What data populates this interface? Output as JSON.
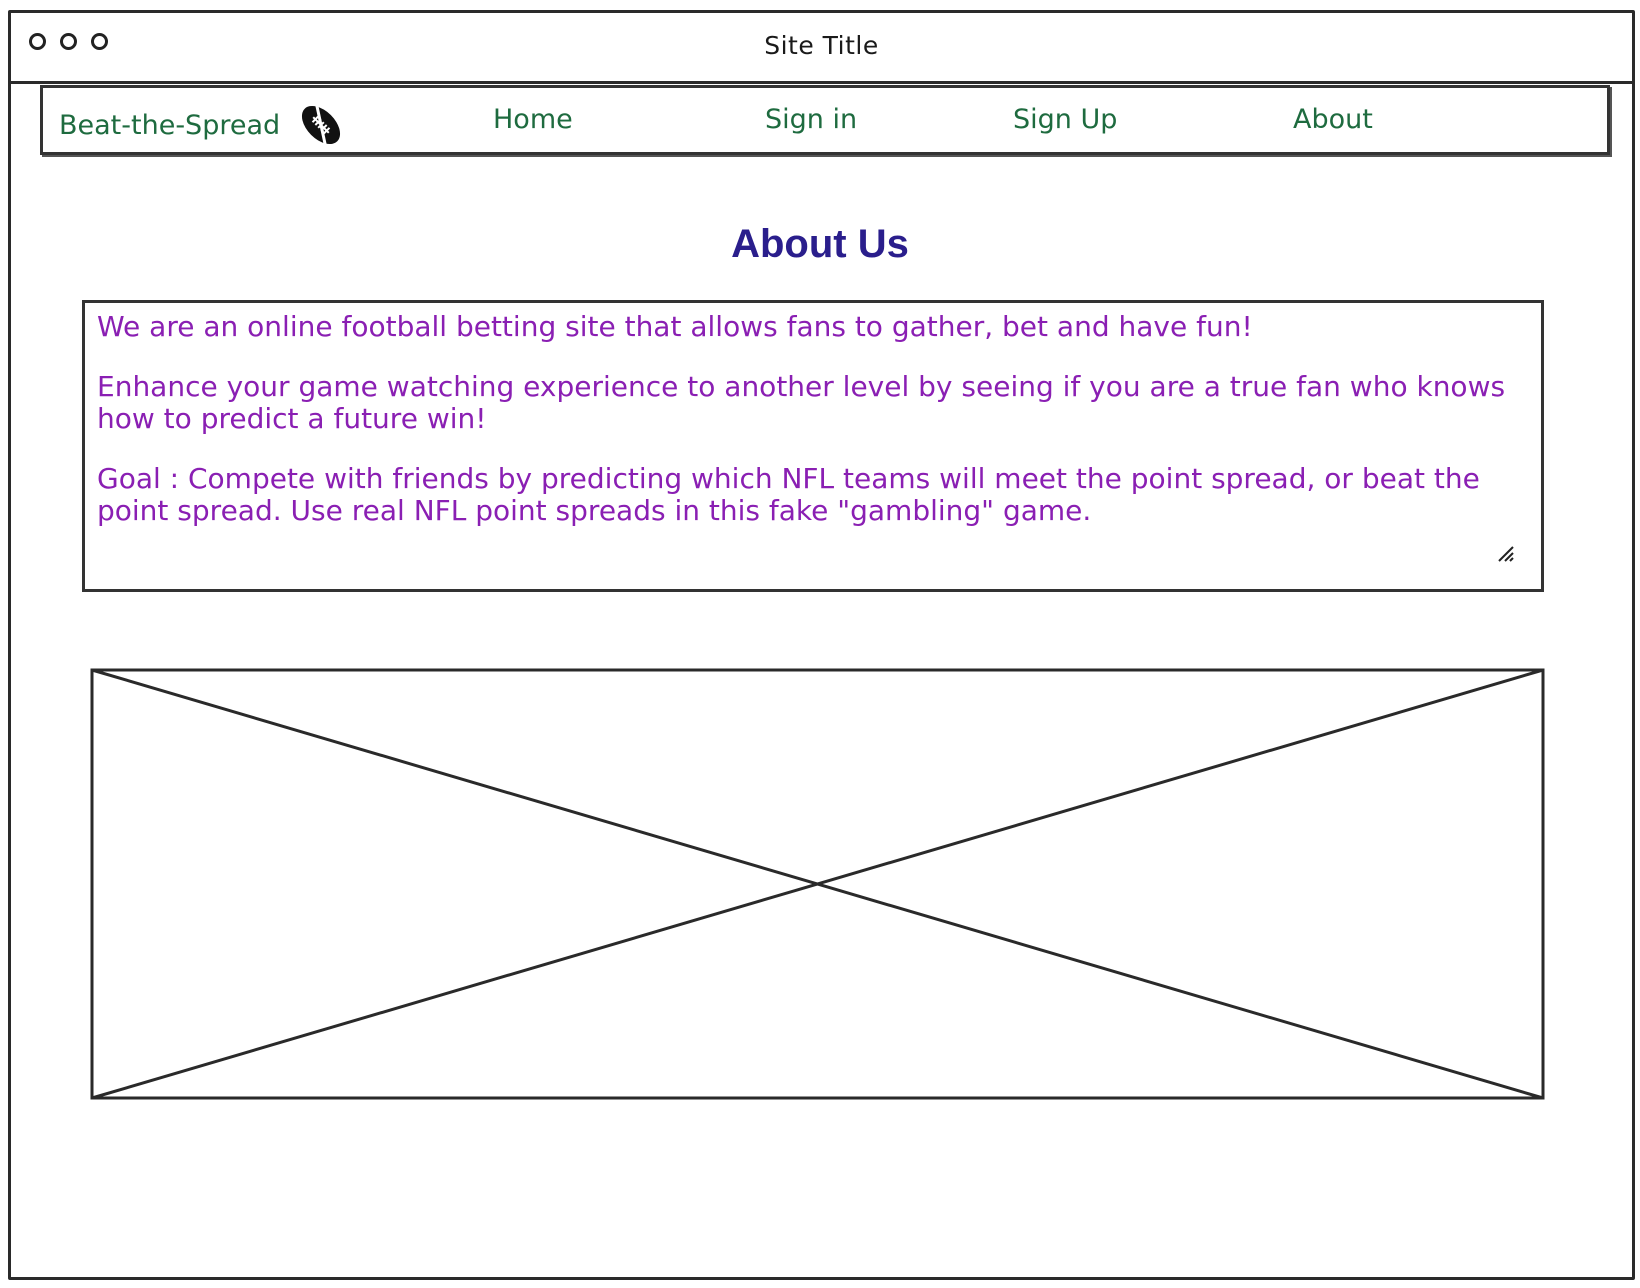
{
  "window": {
    "title": "Site Title"
  },
  "nav": {
    "brand": "Beat-the-Spread",
    "brand_icon": "football-icon",
    "items": [
      {
        "label": "Home"
      },
      {
        "label": "Sign in"
      },
      {
        "label": "Sign Up"
      },
      {
        "label": "About"
      }
    ],
    "link_color": "#1e6b3f"
  },
  "main": {
    "heading": "About Us",
    "heading_color": "#2a1e8c",
    "text_color": "#8a1fb3",
    "paragraphs": [
      "We are an online football betting site that allows fans to gather, bet and have fun!",
      "Enhance your game watching experience to another level by seeing if you are a true fan who knows how to predict a future win!",
      "Goal : Compete with friends by predicting which NFL teams will meet the point spread, or beat the point spread. Use real NFL point spreads in this fake \"gambling\" game."
    ],
    "image_placeholder_icon": "image-placeholder-icon"
  }
}
